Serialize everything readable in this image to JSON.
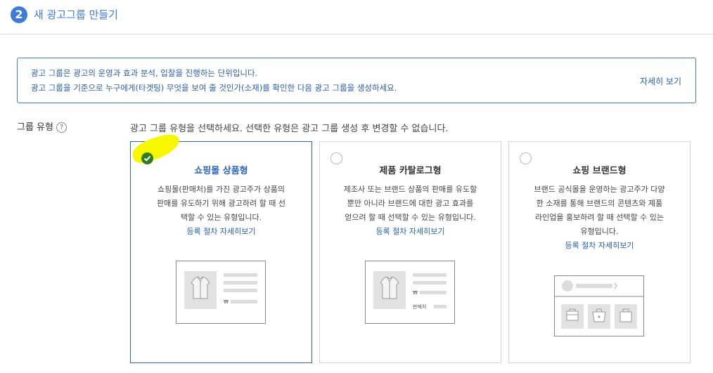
{
  "header": {
    "step": "2",
    "title": "새 광고그룹 만들기"
  },
  "info": {
    "line1": "광고 그룹은 광고의 운영과 효과 분석, 입찰을 진행하는 단위입니다.",
    "line2": "광고 그룹을 기준으로 누구에게(타겟팅) 무엇을 보여 줄 것인가(소재)를 확인한 다음 광고 그룹을 생성하세요.",
    "more": "자세히 보기"
  },
  "group_type": {
    "label": "그룹 유형",
    "help_icon": "question-circle-icon",
    "instruction": "광고 그룹 유형을 선택하세요. 선택한 유형은 광고 그룹 생성 후 변경할 수 없습니다."
  },
  "cards": [
    {
      "title": "쇼핑몰 상품형",
      "desc": [
        "쇼핑몰(판매처)를 가진 광고주가 상품의",
        "판매를 유도하기 위해 광고하려 할 때 선",
        "택할 수 있는 유형입니다."
      ],
      "link": "등록 절차 자세히보기",
      "selected": true,
      "price_symbol": "₩"
    },
    {
      "title": "제품 카탈로그형",
      "desc": [
        "제조사 또는 브랜드 상품의 판매를 유도할",
        "뿐만 아니라 브랜드에 대한 광고 효과를",
        "얻으려 할 때 선택할 수 있는 유형입니다."
      ],
      "link": "등록 절차 자세히보기",
      "selected": false,
      "price_symbol": "₩",
      "seller_label": "판매처"
    },
    {
      "title": "쇼핑 브랜드형",
      "desc": [
        "브랜드 공식몰을 운영하는 광고주가 다양",
        "한 소재를 통해 브랜드의 콘텐츠와 제품",
        "라인업을 홍보하려 할 때 선택할 수 있는",
        "유형입니다."
      ],
      "link": "등록 절차 자세히보기",
      "selected": false
    }
  ],
  "colors": {
    "accent": "#3d7bd6",
    "check": "#2e7d1f",
    "highlight": "#f7f700"
  }
}
